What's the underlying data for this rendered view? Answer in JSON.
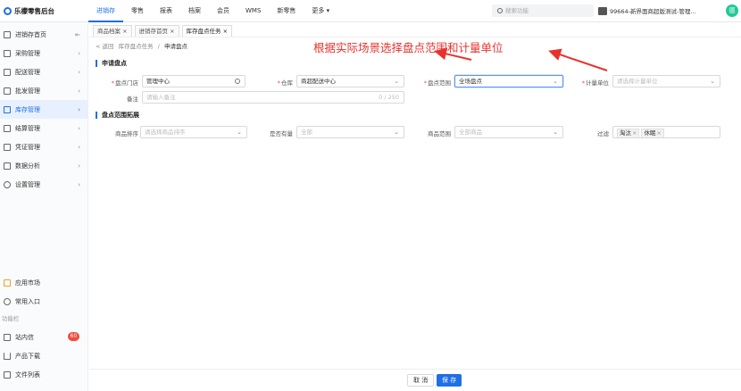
{
  "app": {
    "title": "乐檬零售后台"
  },
  "top_nav": [
    "进销存",
    "零售",
    "报表",
    "档案",
    "会员",
    "WMS",
    "新零售",
    "更多"
  ],
  "search": {
    "placeholder": "搜索功能"
  },
  "store": {
    "name": "99664-新界面商超版测试-管理..."
  },
  "avatar": {
    "text": "德"
  },
  "sidebar": {
    "items": [
      {
        "label": "进销存首页"
      },
      {
        "label": "采购管理"
      },
      {
        "label": "配送管理"
      },
      {
        "label": "批发管理"
      },
      {
        "label": "库存管理"
      },
      {
        "label": "结算管理"
      },
      {
        "label": "凭证管理"
      },
      {
        "label": "数据分析"
      },
      {
        "label": "设置管理"
      }
    ],
    "bottom": [
      {
        "label": "应用市场"
      },
      {
        "label": "常用入口"
      }
    ],
    "section_label": "功能栏",
    "tools": [
      {
        "label": "站内信",
        "badge": "60"
      },
      {
        "label": "产品下载"
      },
      {
        "label": "文件列表"
      }
    ]
  },
  "tabs": [
    "商品档案 ×",
    "进销存首页 ×",
    "库存盘点任务 ×"
  ],
  "breadcrumb": {
    "back": "< 返回",
    "parent": "库存盘点任务",
    "sep": "/",
    "current": "申请盘点"
  },
  "annotation": "根据实际场景选择盘点范围和计量单位",
  "section1": {
    "title": "申请盘点",
    "store_label": "盘点门店",
    "store_value": "管理中心",
    "warehouse_label": "仓库",
    "warehouse_value": "商超配送中心",
    "scope_label": "盘点范围",
    "scope_value": "全场盘点",
    "unit_label": "计量单位",
    "unit_placeholder": "请选择计量单位",
    "remark_label": "备注",
    "remark_placeholder": "请输入备注",
    "remark_count": "0 / 250"
  },
  "section2": {
    "title": "盘点范围拓展",
    "sort_label": "商品排序",
    "sort_placeholder": "请选择商品排序",
    "stock_label": "是否有量",
    "stock_value": "全部",
    "range_label": "商品范围",
    "range_value": "全部商品",
    "filter_label": "过滤",
    "filter_tags": [
      "淘汰",
      "休眠"
    ]
  },
  "footer": {
    "cancel": "取 消",
    "save": "保 存"
  },
  "colors": {
    "accent": "#1f6fe5",
    "annotation": "#e8332d",
    "badge": "#f5493c"
  }
}
